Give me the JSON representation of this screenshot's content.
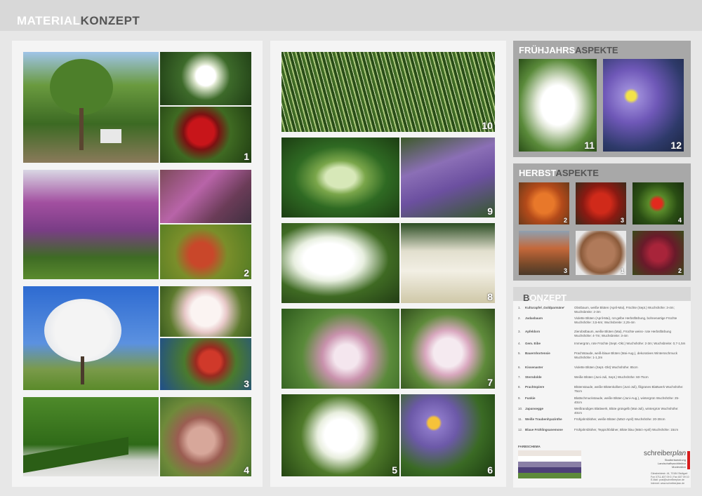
{
  "header": {
    "title_light": "MATERIAL",
    "title_dark": "KONZEPT"
  },
  "photo_numbers": [
    "1",
    "2",
    "3",
    "4",
    "10",
    "9",
    "8",
    "7",
    "5",
    "6"
  ],
  "fruehjahr": {
    "title_light": "FRÜHJAHRS",
    "title_dark": "ASPEKTE",
    "numbers": [
      "11",
      "12"
    ]
  },
  "herbst": {
    "title_light": "HERBST",
    "title_dark": "ASPEKTE",
    "numbers": [
      "2",
      "3",
      "4",
      "3",
      "1",
      "2"
    ]
  },
  "konzept": {
    "title_light": "KONZEPT",
    "title_dark": "B",
    "rows": [
      {
        "n": "1.",
        "name": "Kulturapfel ‚Goldparmäne'",
        "desc": "Obstbaum, weiße Blüten (April-Mai), Früchte (Sept.) Wuchshöhe: 3-4m; Wuchsbreite: 2-3m"
      },
      {
        "n": "2.",
        "name": "Judasbaum",
        "desc": "Violette Blüten (April-Mai), rot-gelbe Herbstfärbung, bohnenartige Früchte Wuchshöhe: 3,5-6m; Wuchsbreite: 2,25-4m"
      },
      {
        "n": "3.",
        "name": "Apfeldorn",
        "desc": "Zierobstbaum, weiße Blüten (Mai), Früchte weiss- rote Herbstfärbung Wuchshöhe: 4-7m; Wuchsbreite: 3-4m"
      },
      {
        "n": "4.",
        "name": "Gem. Eibe",
        "desc": "Immergrün, rote Früchte (Sept.-Okt.) Wuchshöhe: 2-3m; Wuchsbreite: 0,7-1,5m"
      },
      {
        "n": "5.",
        "name": "Bauernhortensie",
        "desc": "Prachtstaude, weiß-blaue Blüten (Mai-Aug.), dekoratives Wintersschmuck Wuchshöhe: 1-1,3m"
      },
      {
        "n": "6.",
        "name": "Kissenaster",
        "desc": "Violette Blüten (Sept.-Okt) Wuchshöhe: 85cm"
      },
      {
        "n": "7.",
        "name": "Sterndolde",
        "desc": "Weiße Blüten (Juni-Juli, Sept.) Wuchshöhe: 60-75cm"
      },
      {
        "n": "8.",
        "name": "Prachtspiere",
        "desc": "Blütenstaude, weiße Blütenkolben (Juni-Juli), filigranes Blattwerk Wuchshöhe: 75cm"
      },
      {
        "n": "9.",
        "name": "Funkie",
        "desc": "Blattschmuckstaude, weiße Blüten (Juni-Aug.), wintergrün Wuchshöhe: 25-40cm"
      },
      {
        "n": "10.",
        "name": "Japansegge",
        "desc": "Weißrandiges Blattwerk, Blüte grüngelb (Mai-Juli), wintergrün Wuchshöhe: 40cm"
      },
      {
        "n": "11.",
        "name": "Weiße Traubenhyazinthe",
        "desc": "Frühjahrsblüher, weiße Blüten (März-April) Wuchshöhe: 20-30cm"
      },
      {
        "n": "12.",
        "name": "Blaue Frühlingsanemone",
        "desc": "Frühjahrsblüher, Teppichbildner, Blüte blau (März-April) Wuchshöhe: 15cm"
      }
    ],
    "farbschema_label": "FARBSCHEMA",
    "swatches": [
      "#ece5df",
      "#ffffff",
      "#8a7fa6",
      "#4d3f78",
      "#5d8a3a"
    ]
  },
  "logo": {
    "name_a": "schreiber",
    "name_b": "plan",
    "line1": "Stadtentwicklung",
    "line2": "Landschaftsarchitektur",
    "line3": "Moderation",
    "addr1": "Gänsheidestr. 44, 70184 Stuttgart",
    "addr2": "Fon 0711-607 09 0 | Fax 607 09 10",
    "addr3": "E-Mail: post@schreiberplan.de",
    "addr4": "Internet: www.schreiberplan.de"
  }
}
